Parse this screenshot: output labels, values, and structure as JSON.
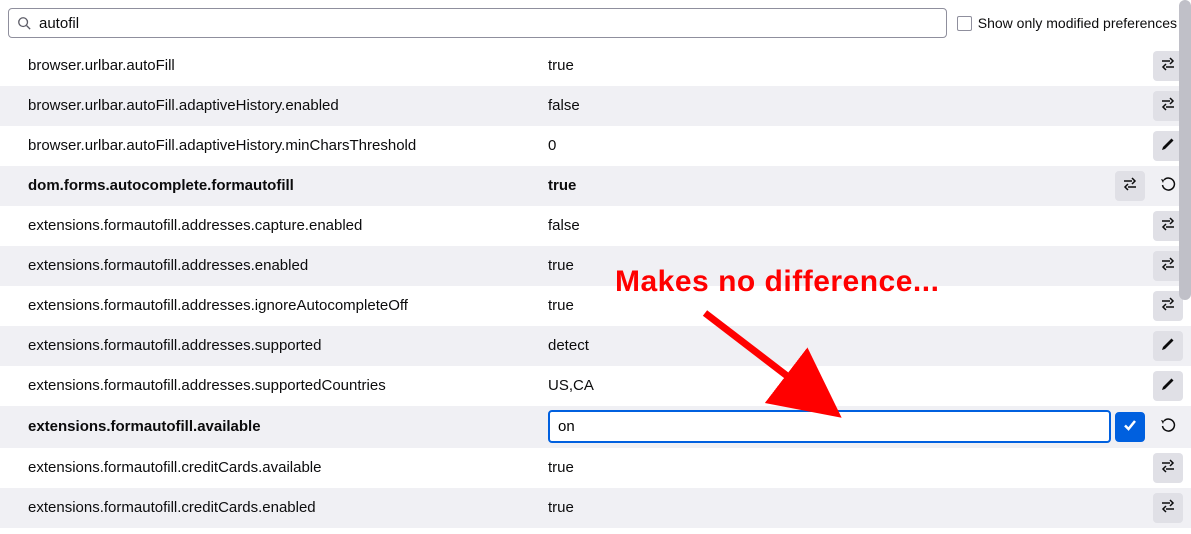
{
  "search": {
    "value": "autofil"
  },
  "show_modified_label": "Show only modified preferences",
  "annotation_text": "Makes no difference...",
  "rows": [
    {
      "name": "browser.urlbar.autoFill",
      "value": "true",
      "action": "toggle",
      "modified": false,
      "reset": false,
      "editing": false
    },
    {
      "name": "browser.urlbar.autoFill.adaptiveHistory.enabled",
      "value": "false",
      "action": "toggle",
      "modified": false,
      "reset": false,
      "editing": false
    },
    {
      "name": "browser.urlbar.autoFill.adaptiveHistory.minCharsThreshold",
      "value": "0",
      "action": "edit",
      "modified": false,
      "reset": false,
      "editing": false
    },
    {
      "name": "dom.forms.autocomplete.formautofill",
      "value": "true",
      "action": "toggle",
      "modified": true,
      "reset": true,
      "editing": false
    },
    {
      "name": "extensions.formautofill.addresses.capture.enabled",
      "value": "false",
      "action": "toggle",
      "modified": false,
      "reset": false,
      "editing": false
    },
    {
      "name": "extensions.formautofill.addresses.enabled",
      "value": "true",
      "action": "toggle",
      "modified": false,
      "reset": false,
      "editing": false
    },
    {
      "name": "extensions.formautofill.addresses.ignoreAutocompleteOff",
      "value": "true",
      "action": "toggle",
      "modified": false,
      "reset": false,
      "editing": false
    },
    {
      "name": "extensions.formautofill.addresses.supported",
      "value": "detect",
      "action": "edit",
      "modified": false,
      "reset": false,
      "editing": false
    },
    {
      "name": "extensions.formautofill.addresses.supportedCountries",
      "value": "US,CA",
      "action": "edit",
      "modified": false,
      "reset": false,
      "editing": false
    },
    {
      "name": "extensions.formautofill.available",
      "value": "on",
      "action": "save",
      "modified": true,
      "reset": true,
      "editing": true
    },
    {
      "name": "extensions.formautofill.creditCards.available",
      "value": "true",
      "action": "toggle",
      "modified": false,
      "reset": false,
      "editing": false
    },
    {
      "name": "extensions.formautofill.creditCards.enabled",
      "value": "true",
      "action": "toggle",
      "modified": false,
      "reset": false,
      "editing": false
    }
  ]
}
